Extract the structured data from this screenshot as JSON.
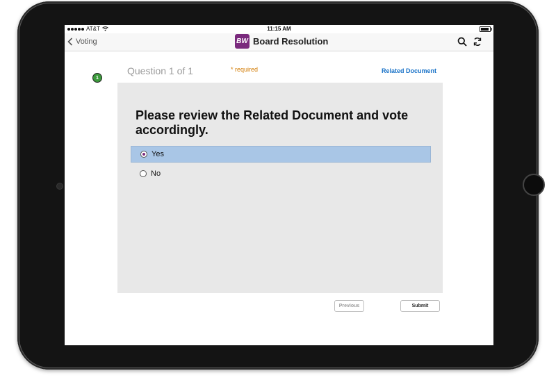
{
  "status": {
    "carrier": "AT&T",
    "time": "11:15 AM"
  },
  "nav": {
    "back_label": "Voting",
    "logo_text": "BW",
    "title": "Board Resolution",
    "icons": [
      "search-icon",
      "refresh-icon"
    ]
  },
  "question": {
    "step": "1",
    "counter": "Question 1 of 1",
    "required_label": "* required",
    "related_link": "Related Document",
    "text": "Please review the Related Document and vote accordingly.",
    "options": [
      {
        "label": "Yes",
        "selected": true
      },
      {
        "label": "No",
        "selected": false
      }
    ]
  },
  "actions": {
    "previous_label": "Previous",
    "submit_label": "Submit"
  },
  "colors": {
    "accent": "#7a2a7d",
    "link": "#1a73c8",
    "required": "#d27a00",
    "selected_row": "#a9c6e6",
    "step_badge": "#3c9a3c"
  }
}
